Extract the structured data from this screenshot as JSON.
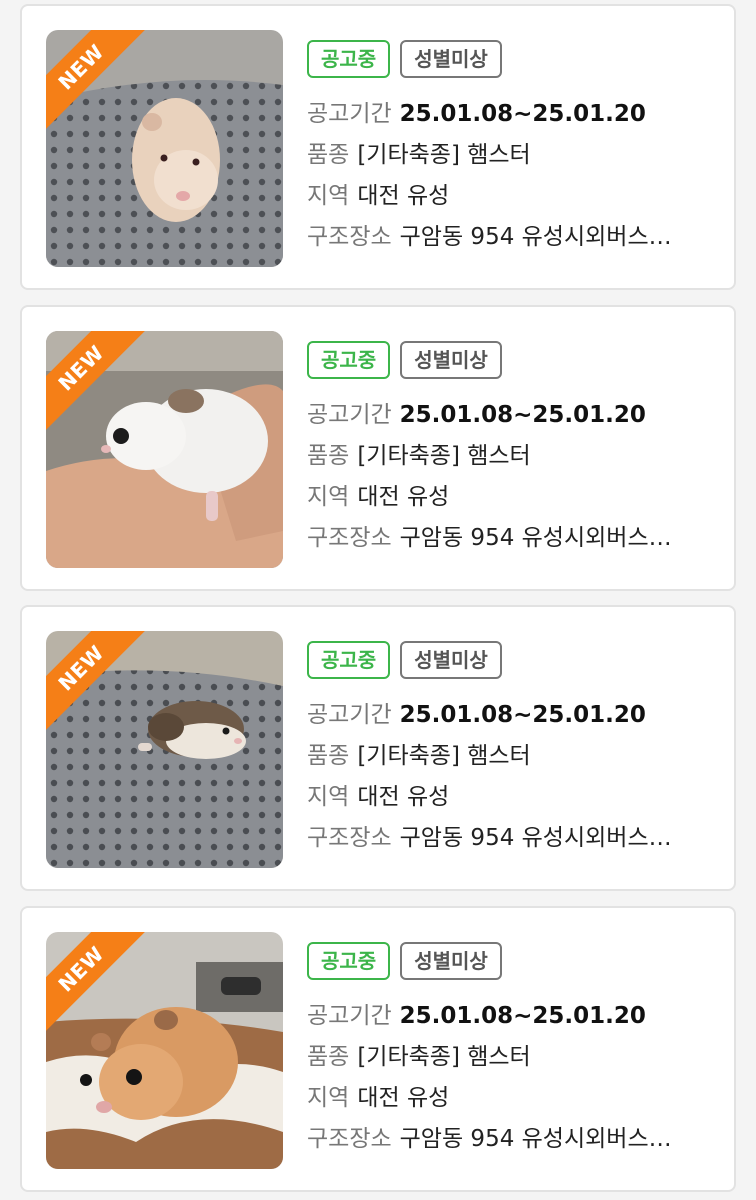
{
  "colors": {
    "status_green": "#3cb54a",
    "new_orange": "#f57f17",
    "sex_gray": "#777777"
  },
  "labels": {
    "period": "공고기간",
    "breed": "품종",
    "region": "지역",
    "rescue": "구조장소"
  },
  "cards": [
    {
      "new_badge": "NEW",
      "status": "공고중",
      "sex": "성별미상",
      "period": "25.01.08~25.01.20",
      "breed": "[기타축종] 햄스터",
      "region": "대전 유성",
      "rescue": "구암동 954 유성시외버스…",
      "photo": "cream-hamster-on-gray-mat"
    },
    {
      "new_badge": "NEW",
      "status": "공고중",
      "sex": "성별미상",
      "period": "25.01.08~25.01.20",
      "breed": "[기타축종] 햄스터",
      "region": "대전 유성",
      "rescue": "구암동 954 유성시외버스…",
      "photo": "white-hamster-in-hand"
    },
    {
      "new_badge": "NEW",
      "status": "공고중",
      "sex": "성별미상",
      "period": "25.01.08~25.01.20",
      "breed": "[기타축종] 햄스터",
      "region": "대전 유성",
      "rescue": "구암동 954 유성시외버스…",
      "photo": "brown-white-hamster-on-gray-mat"
    },
    {
      "new_badge": "NEW",
      "status": "공고중",
      "sex": "성별미상",
      "period": "25.01.08~25.01.20",
      "breed": "[기타축종] 햄스터",
      "region": "대전 유성",
      "rescue": "구암동 954 유성시외버스…",
      "photo": "golden-hamster-on-rug"
    }
  ]
}
